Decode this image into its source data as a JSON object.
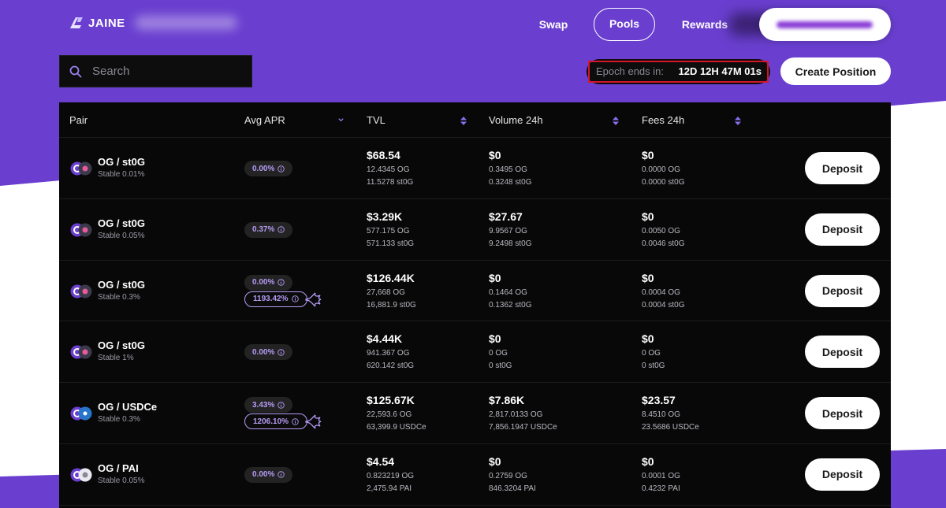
{
  "brand": {
    "name": "JAINE"
  },
  "nav": {
    "swap": "Swap",
    "pools": "Pools",
    "rewards": "Rewards"
  },
  "search": {
    "placeholder": "Search"
  },
  "epoch": {
    "label": "Epoch ends in:",
    "value": "12D 12H 47M 01s"
  },
  "actions": {
    "create_position": "Create Position",
    "deposit": "Deposit"
  },
  "table": {
    "headers": {
      "pair": "Pair",
      "avg_apr": "Avg APR",
      "tvl": "TVL",
      "volume": "Volume 24h",
      "fees": "Fees 24h"
    },
    "rows": [
      {
        "pair": "OG / st0G",
        "fee": "Stable 0.01%",
        "apr": "0.00%",
        "boost": "",
        "tvl": "$68.54",
        "tvl_a": "12.4345 OG",
        "tvl_b": "11.5278 st0G",
        "vol": "$0",
        "vol_a": "0.3495 OG",
        "vol_b": "0.3248 st0G",
        "fees": "$0",
        "fees_a": "0.0000 OG",
        "fees_b": "0.0000 st0G"
      },
      {
        "pair": "OG / st0G",
        "fee": "Stable 0.05%",
        "apr": "0.37%",
        "boost": "",
        "tvl": "$3.29K",
        "tvl_a": "577.175 OG",
        "tvl_b": "571.133 st0G",
        "vol": "$27.67",
        "vol_a": "9.9567 OG",
        "vol_b": "9.2498 st0G",
        "fees": "$0",
        "fees_a": "0.0050 OG",
        "fees_b": "0.0046 st0G"
      },
      {
        "pair": "OG / st0G",
        "fee": "Stable 0.3%",
        "apr": "0.00%",
        "boost": "1193.42%",
        "tvl": "$126.44K",
        "tvl_a": "27,668 OG",
        "tvl_b": "16,881.9 st0G",
        "vol": "$0",
        "vol_a": "0.1464 OG",
        "vol_b": "0.1362 st0G",
        "fees": "$0",
        "fees_a": "0.0004 OG",
        "fees_b": "0.0004 st0G"
      },
      {
        "pair": "OG / st0G",
        "fee": "Stable 1%",
        "apr": "0.00%",
        "boost": "",
        "tvl": "$4.44K",
        "tvl_a": "941.367 OG",
        "tvl_b": "620.142 st0G",
        "vol": "$0",
        "vol_a": "0 OG",
        "vol_b": "0 st0G",
        "fees": "$0",
        "fees_a": "0 OG",
        "fees_b": "0 st0G"
      },
      {
        "pair": "OG / USDCe",
        "fee": "Stable 0.3%",
        "apr": "3.43%",
        "boost": "1206.10%",
        "tvl": "$125.67K",
        "tvl_a": "22,593.6 OG",
        "tvl_b": "63,399.9 USDCe",
        "vol": "$7.86K",
        "vol_a": "2,817.0133 OG",
        "vol_b": "7,856.1947 USDCe",
        "fees": "$23.57",
        "fees_a": "8.4510 OG",
        "fees_b": "23.5686 USDCe"
      },
      {
        "pair": "OG / PAI",
        "fee": "Stable 0.05%",
        "apr": "0.00%",
        "boost": "",
        "tvl": "$4.54",
        "tvl_a": "0.823219 OG",
        "tvl_b": "2,475.94 PAI",
        "vol": "$0",
        "vol_a": "0.2759 OG",
        "vol_b": "846.3204 PAI",
        "fees": "$0",
        "fees_a": "0.0001 OG",
        "fees_b": "0.4232 PAI"
      }
    ]
  },
  "colors": {
    "brand": "#6a3fd0",
    "accent": "#b69bf5",
    "epoch_outline": "#d4162a"
  }
}
